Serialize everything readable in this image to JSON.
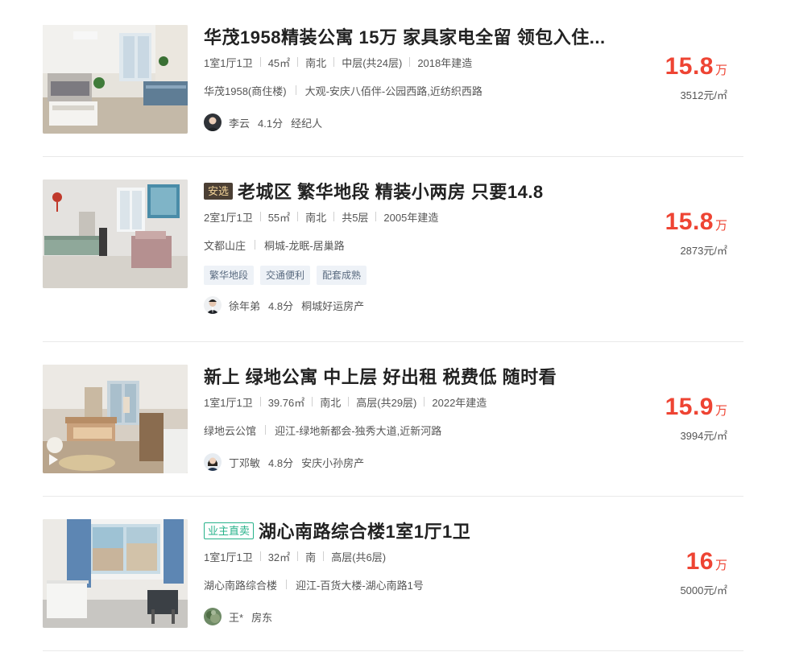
{
  "listings": [
    {
      "tag": "",
      "title": "华茂1958精装公寓 15万 家具家电全留 领包入住...",
      "layout": "1室1厅1卫",
      "area": "45㎡",
      "orientation": "南北",
      "floor": "中层(共24层)",
      "built": "2018年建造",
      "community": "华茂1958(商住楼)",
      "location": "大观-安庆八佰伴-公园西路,近纺织西路",
      "features": [],
      "broker_name": "李云",
      "broker_score": "4.1分",
      "broker_company": "经纪人",
      "price_num": "15.8",
      "price_unit": "万",
      "unit_price": "3512元/㎡"
    },
    {
      "tag": "安选",
      "title": "老城区 繁华地段 精装小两房 只要14.8",
      "layout": "2室1厅1卫",
      "area": "55㎡",
      "orientation": "南北",
      "floor": "共5层",
      "built": "2005年建造",
      "community": "文都山庄",
      "location": "桐城-龙眠-居巢路",
      "features": [
        "繁华地段",
        "交通便利",
        "配套成熟"
      ],
      "broker_name": "徐年弟",
      "broker_score": "4.8分",
      "broker_company": "桐城好运房产",
      "price_num": "15.8",
      "price_unit": "万",
      "unit_price": "2873元/㎡"
    },
    {
      "tag": "",
      "title": "新上 绿地公寓 中上层 好出租 税费低 随时看",
      "layout": "1室1厅1卫",
      "area": "39.76㎡",
      "orientation": "南北",
      "floor": "高层(共29层)",
      "built": "2022年建造",
      "community": "绿地云公馆",
      "location": "迎江-绿地新都会-独秀大道,近新河路",
      "features": [],
      "broker_name": "丁邓敏",
      "broker_score": "4.8分",
      "broker_company": "安庆小孙房产",
      "price_num": "15.9",
      "price_unit": "万",
      "unit_price": "3994元/㎡"
    },
    {
      "tag": "业主直卖",
      "title": "湖心南路综合楼1室1厅1卫",
      "layout": "1室1厅1卫",
      "area": "32㎡",
      "orientation": "南",
      "floor": "高层(共6层)",
      "built": "",
      "community": "湖心南路综合楼",
      "location": "迎江-百货大楼-湖心南路1号",
      "features": [],
      "broker_name": "王*",
      "broker_score": "",
      "broker_company": "房东",
      "price_num": "16",
      "price_unit": "万",
      "unit_price": "5000元/㎡"
    }
  ],
  "colors": {
    "price": "#ee4433",
    "tag_anxuan_bg": "#4b3f34",
    "tag_anxuan_text": "#f4d59a",
    "tag_owner": "#27b28a",
    "feature_bg": "#eef2f7",
    "feature_text": "#5a6b80"
  },
  "icons": [
    "play-icon"
  ]
}
